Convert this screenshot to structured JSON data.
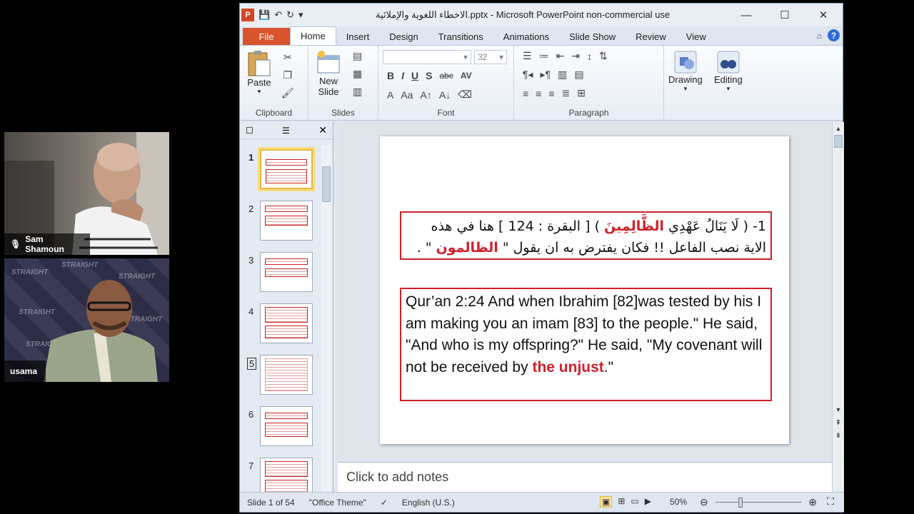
{
  "participants": [
    {
      "name": "Sam Shamoun",
      "muted": true
    },
    {
      "name": "usama",
      "muted": false
    }
  ],
  "watermark": "STRAIGHT",
  "window": {
    "title": "الاخطاء اللغوية والإملائية.pptx  -  Microsoft PowerPoint non-commercial use",
    "app_icon": "P"
  },
  "tabs": [
    "File",
    "Home",
    "Insert",
    "Design",
    "Transitions",
    "Animations",
    "Slide Show",
    "Review",
    "View"
  ],
  "ribbon": {
    "clipboard": {
      "label": "Clipboard",
      "paste": "Paste"
    },
    "slides": {
      "label": "Slides",
      "new_slide_1": "New",
      "new_slide_2": "Slide"
    },
    "font": {
      "label": "Font",
      "size": "32"
    },
    "paragraph": {
      "label": "Paragraph"
    },
    "drawing": "Drawing",
    "editing": "Editing"
  },
  "thumbnails": [
    "1",
    "2",
    "3",
    "4",
    "5",
    "6",
    "7"
  ],
  "slide": {
    "arabic_line1_a": "1- ( لَا يَنَالُ عَهْدِي ",
    "arabic_line1_red": "الظَّالِمِينَ",
    "arabic_line1_b": " ) [ البقرة : 124 ] هنا في هذه",
    "arabic_line2_a": "الاية نصب الفاعل !! فكان يفترض به ان يقول \" ",
    "arabic_line2_red": "الظالمون",
    "arabic_line2_b": " \" .",
    "english_a": "Qur’an 2:24 And when Ibrahim [82]was tested by his  I am making you an imam [83] to the people.\" He said, \"And who is my offspring?\" He said, \"My covenant will not be received by ",
    "english_red": "the unjust",
    "english_b": ".\""
  },
  "notes_placeholder": "Click to add notes",
  "status": {
    "slide": "Slide 1 of 54",
    "theme": "\"Office Theme\"",
    "language": "English (U.S.)",
    "zoom": "50%"
  }
}
